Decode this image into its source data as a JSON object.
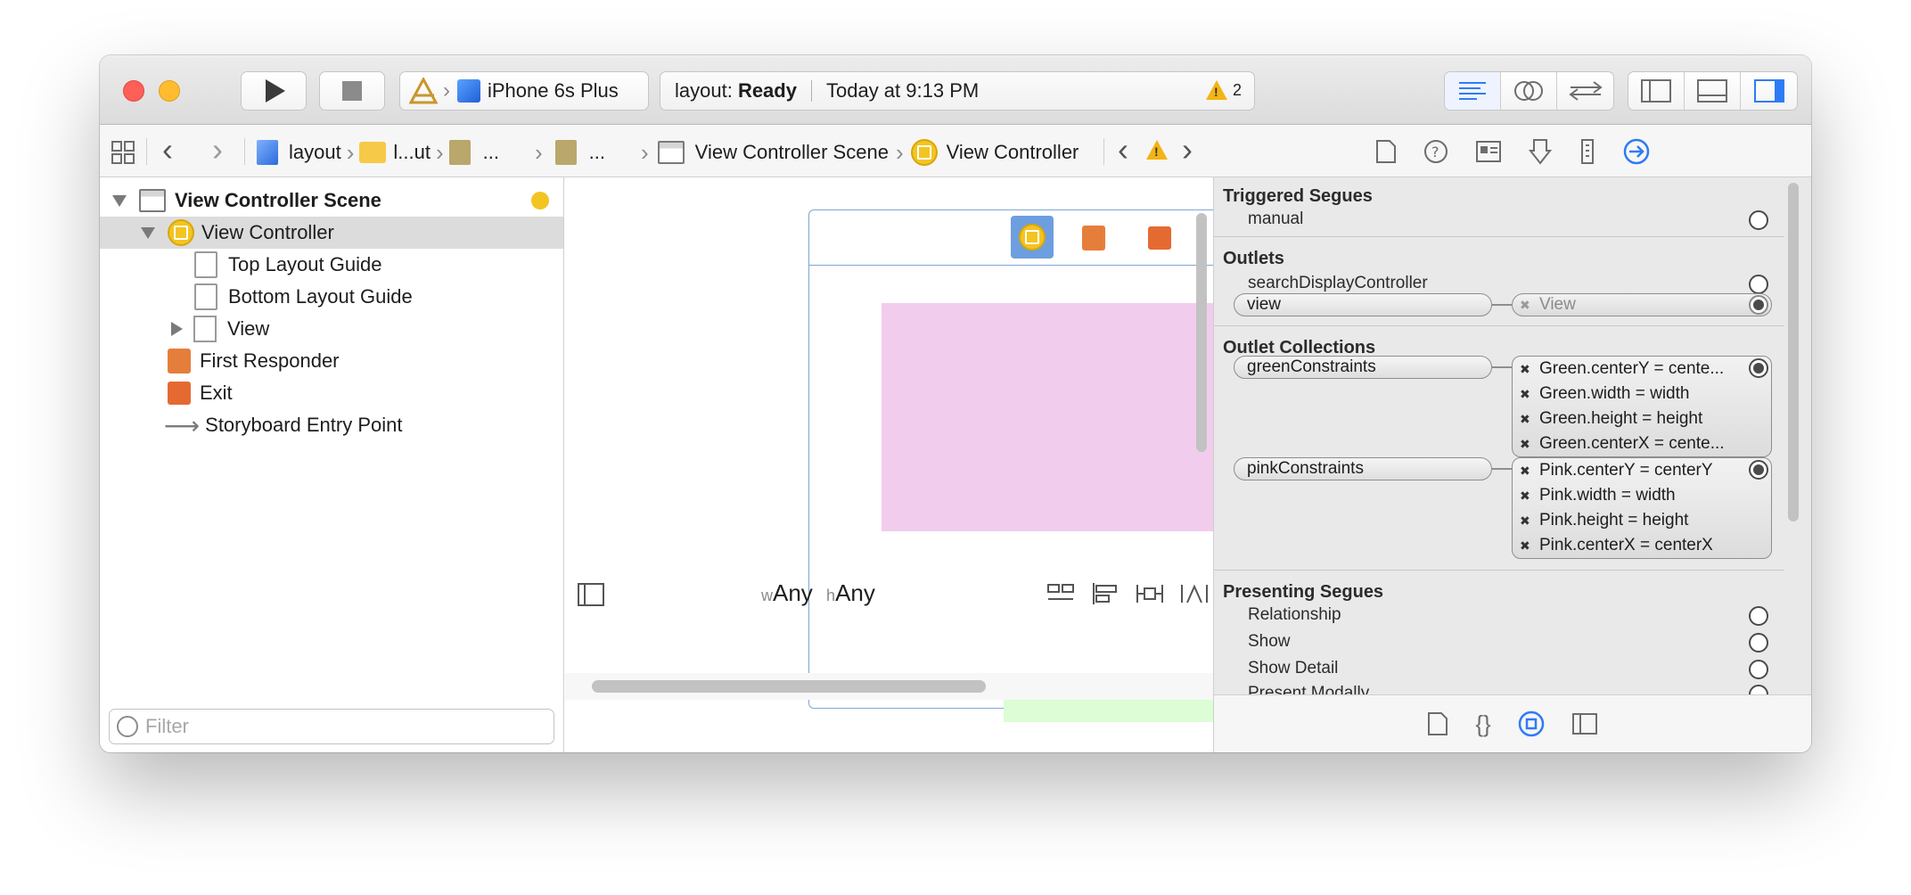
{
  "toolbar": {
    "scheme_device": "iPhone 6s Plus",
    "activity_prefix": "layout: ",
    "activity_status": "Ready",
    "activity_time": "Today at 9:13 PM",
    "warning_count": "2"
  },
  "jump_bar": {
    "crumbs": [
      "layout",
      "l...ut",
      "...",
      "...",
      "View Controller Scene",
      "View Controller"
    ]
  },
  "outline": {
    "scene": "View Controller Scene",
    "vc": "View Controller",
    "top_guide": "Top Layout Guide",
    "bottom_guide": "Bottom Layout Guide",
    "view": "View",
    "first_responder": "First Responder",
    "exit": "Exit",
    "entry_point": "Storyboard Entry Point"
  },
  "filter": {
    "placeholder": "Filter"
  },
  "size_class": {
    "w_prefix": "w",
    "w_value": "Any",
    "h_prefix": "h",
    "h_value": "Any"
  },
  "inspector": {
    "triggered_segues": {
      "title": "Triggered Segues",
      "manual": "manual"
    },
    "outlets": {
      "title": "Outlets",
      "search": "searchDisplayController",
      "view_outlet": "view",
      "view_target": "View"
    },
    "outlet_collections": {
      "title": "Outlet Collections",
      "green": {
        "name": "greenConstraints",
        "items": [
          "Green.centerY = cente...",
          "Green.width = width",
          "Green.height = height",
          "Green.centerX = cente..."
        ]
      },
      "pink": {
        "name": "pinkConstraints",
        "items": [
          "Pink.centerY = centerY",
          "Pink.width = width",
          "Pink.height = height",
          "Pink.centerX = centerX"
        ]
      }
    },
    "presenting_segues": {
      "title": "Presenting Segues",
      "items": [
        "Relationship",
        "Show",
        "Show Detail",
        "Present Modally"
      ]
    }
  },
  "colors": {
    "pink_view": "#f2ccec",
    "green_view": "#dcfdd6",
    "accent": "#2f7bf5"
  }
}
